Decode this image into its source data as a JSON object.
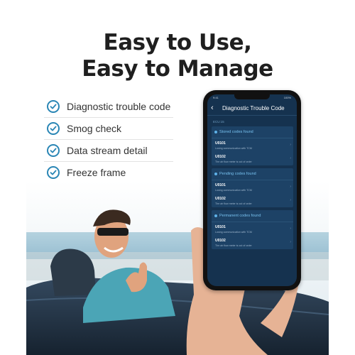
{
  "headline": {
    "line1": "Easy to Use,",
    "line2": "Easy to Manage"
  },
  "features": [
    {
      "label": "Diagnostic trouble code"
    },
    {
      "label": "Smog check"
    },
    {
      "label": "Data stream detail"
    },
    {
      "label": "Freeze frame"
    }
  ],
  "phone": {
    "status_time": "9:41",
    "status_battery": "100%",
    "title": "Diagnostic Trouble Code",
    "ecu_label": "ECU:15",
    "groups": [
      {
        "title": "Stored codes found",
        "codes": [
          {
            "id": "U0101",
            "desc": "Losing communication with TCM"
          },
          {
            "id": "U0102",
            "desc": "The air flow meter is out of order"
          }
        ]
      },
      {
        "title": "Pending codes found",
        "codes": [
          {
            "id": "U0101",
            "desc": "Losing communication with TCM"
          },
          {
            "id": "U0102",
            "desc": "The air flow meter is out of order"
          }
        ]
      },
      {
        "title": "Permanent codes found",
        "codes": [
          {
            "id": "U0101",
            "desc": "Losing communication with TCM"
          },
          {
            "id": "U0102",
            "desc": "The air flow meter is out of order"
          }
        ]
      }
    ]
  },
  "colors": {
    "check": "#2a86b5",
    "screen_bg": "#15324f",
    "card_bg": "#1d4266",
    "accent": "#78c2f0"
  }
}
